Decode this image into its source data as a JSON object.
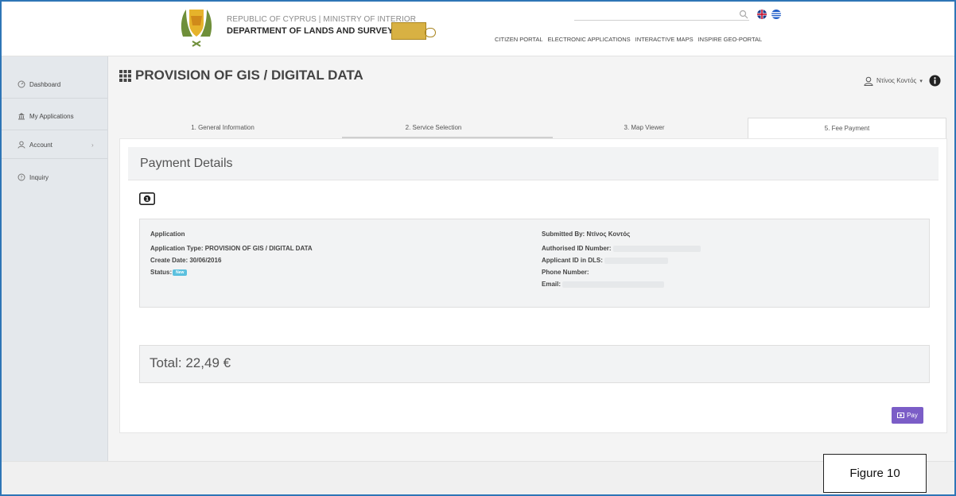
{
  "header": {
    "ministry": "REPUBLIC OF CYPRUS | MINISTRY OF INTERIOR",
    "department": "DEPARTMENT OF LANDS AND SURVEYS",
    "nav": [
      "CITIZEN PORTAL",
      "ELECTRONIC APPLICATIONS",
      "INTERACTIVE MAPS",
      "INSPIRE GEO-PORTAL"
    ]
  },
  "sidebar": {
    "items": [
      {
        "label": "Dashboard",
        "icon": "dashboard-icon"
      },
      {
        "label": "My Applications",
        "icon": "bank-icon"
      },
      {
        "label": "Account",
        "icon": "user-icon"
      },
      {
        "label": "Inquiry",
        "icon": "question-icon"
      }
    ]
  },
  "page": {
    "title": "PROVISION OF GIS / DIGITAL DATA",
    "user": "Ντίνος Κοντός"
  },
  "tabs": [
    "1. General Information",
    "2. Service Selection",
    "3. Map Viewer",
    "5. Fee Payment"
  ],
  "payment": {
    "title": "Payment Details",
    "app_heading": "Application",
    "app_type": "Application Type: PROVISION OF GIS / DIGITAL DATA",
    "create_date": "Create Date: 30/06/2016",
    "status_label": "Status:",
    "status_value": "New",
    "submitted_by": "Submitted By: Ντίνος Κοντός",
    "auth_id": "Authorised ID Number:",
    "applicant_id": "Applicant ID in DLS:",
    "phone": "Phone Number:",
    "email": "Email:",
    "total": "Total: 22,49 €",
    "pay_label": "Pay"
  },
  "figure_label": "Figure 10",
  "colors": {
    "accent": "#7b5dc7",
    "badge": "#5bc0de",
    "frame": "#2e75b6"
  }
}
